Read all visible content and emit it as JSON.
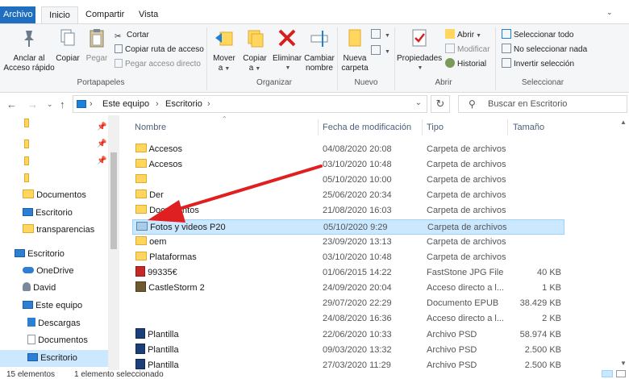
{
  "tabs": {
    "archivo": "Archivo",
    "inicio": "Inicio",
    "compartir": "Compartir",
    "vista": "Vista"
  },
  "ribbon": {
    "portapapeles": {
      "anclar": "Anclar al\nAcceso rápido",
      "anclar_l1": "Anclar al",
      "anclar_l2": "Acceso rápido",
      "copiar": "Copiar",
      "pegar": "Pegar",
      "cortar": "Cortar",
      "copiar_ruta": "Copiar ruta de acceso",
      "pegar_acceso": "Pegar acceso directo",
      "label": "Portapapeles"
    },
    "organizar": {
      "mover_l1": "Mover",
      "mover_l2": "a",
      "copiar_l1": "Copiar",
      "copiar_l2": "a",
      "eliminar": "Eliminar",
      "cambiar_l1": "Cambiar",
      "cambiar_l2": "nombre",
      "label": "Organizar"
    },
    "nuevo": {
      "nueva_l1": "Nueva",
      "nueva_l2": "carpeta",
      "label": "Nuevo"
    },
    "abrir": {
      "propiedades": "Propiedades",
      "abrir": "Abrir",
      "modificar": "Modificar",
      "historial": "Historial",
      "label": "Abrir"
    },
    "seleccionar": {
      "todo": "Seleccionar todo",
      "nada": "No seleccionar nada",
      "invertir": "Invertir selección",
      "label": "Seleccionar"
    }
  },
  "address": {
    "crumb1": "Este equipo",
    "crumb2": "Escritorio",
    "search_placeholder": "Buscar en Escritorio"
  },
  "nav": {
    "items": [
      {
        "label": "",
        "icon": "folder"
      },
      {
        "label": "",
        "icon": "folder"
      },
      {
        "label": "",
        "icon": "folder"
      },
      {
        "label": "",
        "icon": "folder"
      },
      {
        "label": "Documentos",
        "icon": "folder"
      },
      {
        "label": "Escritorio",
        "icon": "desktop"
      },
      {
        "label": "transparencias",
        "icon": "folder"
      },
      {
        "label": "Escritorio",
        "icon": "desktop"
      },
      {
        "label": "OneDrive",
        "icon": "cloud"
      },
      {
        "label": "David",
        "icon": "person"
      },
      {
        "label": "Este equipo",
        "icon": "pc"
      },
      {
        "label": "Descargas",
        "icon": "download"
      },
      {
        "label": "Documentos",
        "icon": "doc"
      },
      {
        "label": "Escritorio",
        "icon": "desktop"
      }
    ]
  },
  "columns": {
    "name": "Nombre",
    "date": "Fecha de modificación",
    "type": "Tipo",
    "size": "Tamaño"
  },
  "files": [
    {
      "name": "Accesos",
      "date": "04/08/2020 20:08",
      "type": "Carpeta de archivos",
      "size": "",
      "icon": "folder"
    },
    {
      "name": "Accesos",
      "date": "03/10/2020 10:48",
      "type": "Carpeta de archivos",
      "size": "",
      "icon": "folder"
    },
    {
      "name": "",
      "date": "05/10/2020 10:00",
      "type": "Carpeta de archivos",
      "size": "",
      "icon": "folder"
    },
    {
      "name": "Der",
      "date": "25/06/2020 20:34",
      "type": "Carpeta de archivos",
      "size": "",
      "icon": "folder"
    },
    {
      "name": "Documentos",
      "date": "21/08/2020 16:03",
      "type": "Carpeta de archivos",
      "size": "",
      "icon": "folder"
    },
    {
      "name": "Fotos y videos P20",
      "date": "05/10/2020 9:29",
      "type": "Carpeta de archivos",
      "size": "",
      "icon": "folder-blue"
    },
    {
      "name": "oem",
      "date": "23/09/2020 13:13",
      "type": "Carpeta de archivos",
      "size": "",
      "icon": "folder"
    },
    {
      "name": "Plataformas",
      "date": "03/10/2020 10:48",
      "type": "Carpeta de archivos",
      "size": "",
      "icon": "folder"
    },
    {
      "name": "99335€",
      "date": "01/06/2015 14:22",
      "type": "FastStone JPG File",
      "size": "40 KB",
      "icon": "jpg"
    },
    {
      "name": "CastleStorm 2",
      "date": "24/09/2020 20:04",
      "type": "Acceso directo a l...",
      "size": "1 KB",
      "icon": "game"
    },
    {
      "name": "",
      "date": "29/07/2020 22:29",
      "type": "Documento EPUB",
      "size": "38.429 KB",
      "icon": "none"
    },
    {
      "name": "",
      "date": "24/08/2020 16:36",
      "type": "Acceso directo a l...",
      "size": "2 KB",
      "icon": "none"
    },
    {
      "name": "Plantilla",
      "date": "22/06/2020 10:33",
      "type": "Archivo PSD",
      "size": "58.974 KB",
      "icon": "psd"
    },
    {
      "name": "Plantilla",
      "date": "09/03/2020 13:32",
      "type": "Archivo PSD",
      "size": "2.500 KB",
      "icon": "psd"
    },
    {
      "name": "Plantilla",
      "date": "27/03/2020 11:29",
      "type": "Archivo PSD",
      "size": "2.500 KB",
      "icon": "psd"
    }
  ],
  "status": {
    "count": "15 elementos",
    "selected": "1 elemento seleccionado"
  },
  "colors": {
    "accent": "#1f6ebf",
    "selection": "#cce8ff",
    "arrow": "#e02020",
    "folder": "#ffd75e"
  }
}
